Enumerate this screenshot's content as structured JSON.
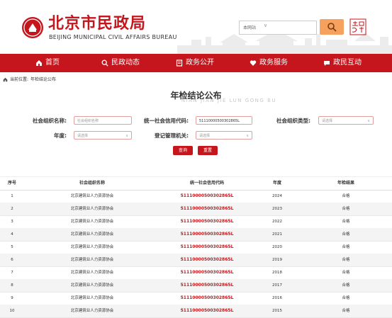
{
  "header": {
    "title": "北京市民政局",
    "subtitle": "BEIJING MUNICIPAL CIVIL AFFAIRS BUREAU",
    "search_scope": "本网站",
    "search_chevron": "∨",
    "accent_color": "#c4161c",
    "search_button_color": "#f6a15d"
  },
  "nav": {
    "items": [
      {
        "label": "首页",
        "icon": "home-icon"
      },
      {
        "label": "民政动态",
        "icon": "search-icon"
      },
      {
        "label": "政务公开",
        "icon": "document-icon"
      },
      {
        "label": "政务服务",
        "icon": "heart-icon"
      },
      {
        "label": "政民互动",
        "icon": "chat-icon"
      }
    ]
  },
  "breadcrumb": {
    "prefix": "当前位置:",
    "current": "年检结论公布"
  },
  "page": {
    "title": "年检结论公布",
    "title_en": "NIAN JIAN JIE LUN GONG BU"
  },
  "form": {
    "org_name_label": "社会组织名称:",
    "org_name_placeholder": "社会组织名称",
    "credit_code_label": "统一社会信用代码:",
    "credit_code_value": "51110000500302865L",
    "org_type_label": "社会组织类型:",
    "org_type_placeholder": "请选择",
    "year_label": "年度:",
    "year_placeholder": "请选择",
    "authority_label": "登记管理机关:",
    "authority_placeholder": "请选择",
    "select_chevron": "∨",
    "query_button": "查询",
    "reset_button": "重置"
  },
  "table": {
    "headers": [
      "序号",
      "社会组织名称",
      "统一社会信用代码",
      "年度",
      "年检结果"
    ],
    "rows": [
      {
        "no": "1",
        "name": "北京建筑业人力资源协会",
        "code": "51110000500302865L",
        "year": "2024",
        "result": "合格"
      },
      {
        "no": "2",
        "name": "北京建筑业人力资源协会",
        "code": "51110000500302865L",
        "year": "2023",
        "result": "合格"
      },
      {
        "no": "3",
        "name": "北京建筑业人力资源协会",
        "code": "51110000500302865L",
        "year": "2022",
        "result": "合格"
      },
      {
        "no": "4",
        "name": "北京建筑业人力资源协会",
        "code": "51110000500302865L",
        "year": "2021",
        "result": "合格"
      },
      {
        "no": "5",
        "name": "北京建筑业人力资源协会",
        "code": "51110000500302865L",
        "year": "2020",
        "result": "合格"
      },
      {
        "no": "6",
        "name": "北京建筑业人力资源协会",
        "code": "51110000500302865L",
        "year": "2019",
        "result": "合格"
      },
      {
        "no": "7",
        "name": "北京建筑业人力资源协会",
        "code": "51110000500302865L",
        "year": "2018",
        "result": "合格"
      },
      {
        "no": "8",
        "name": "北京建筑业人力资源协会",
        "code": "51110000500302865L",
        "year": "2017",
        "result": "合格"
      },
      {
        "no": "9",
        "name": "北京建筑业人力资源协会",
        "code": "51110000500302865L",
        "year": "2016",
        "result": "合格"
      },
      {
        "no": "10",
        "name": "北京建筑业人力资源协会",
        "code": "51110000500302865L",
        "year": "2015",
        "result": "合格"
      }
    ]
  }
}
